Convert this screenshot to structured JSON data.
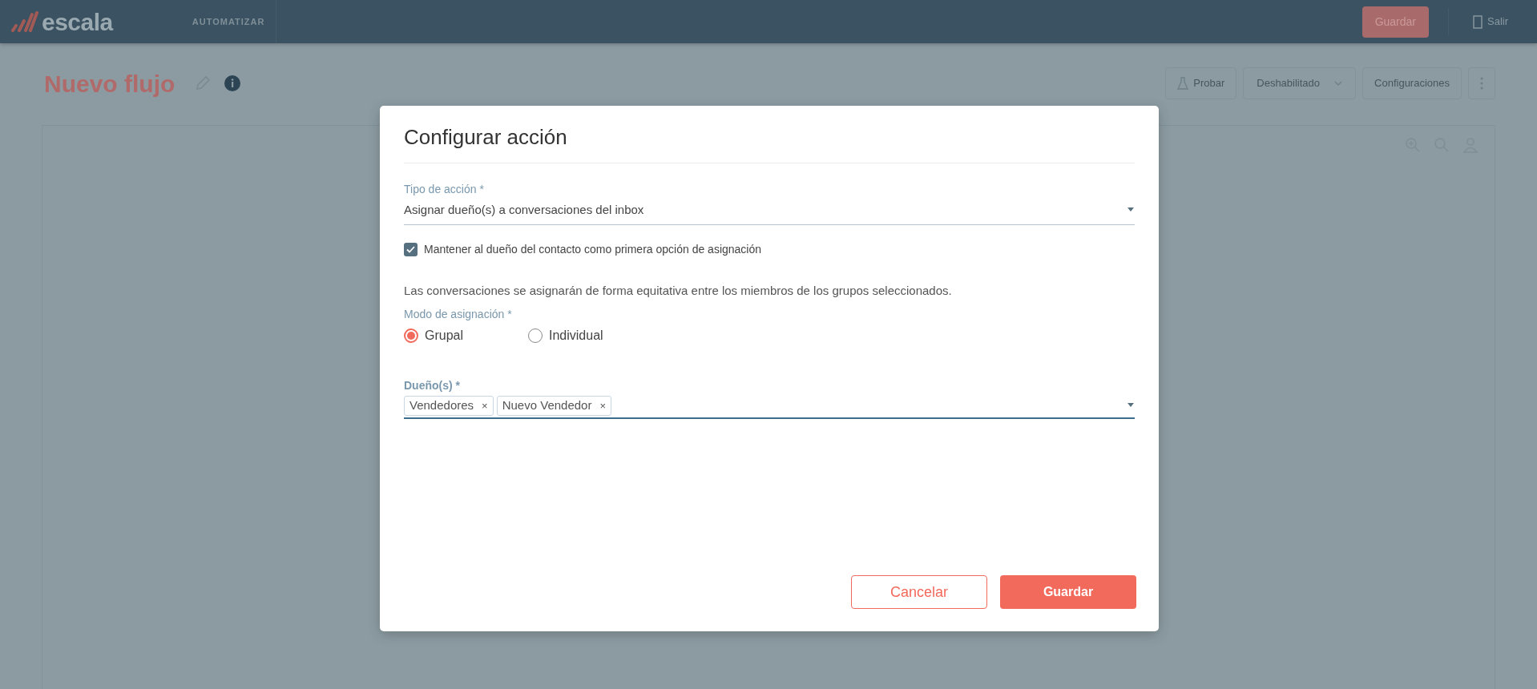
{
  "header": {
    "logo": "escala",
    "nav_item": "AUTOMATIZAR",
    "save_button": "Guardar",
    "exit_button": "Salir"
  },
  "page": {
    "title": "Nuevo flujo",
    "toolbar": [
      {
        "label": "Probar",
        "kind": "icon"
      },
      {
        "label": "Deshabilitado",
        "kind": "dropdown"
      },
      {
        "label": "Configuraciones",
        "kind": "plain"
      }
    ]
  },
  "modal": {
    "title": "Configurar acción",
    "action_type": {
      "label": "Tipo de acción *",
      "value": "Asignar dueño(s) a conversaciones del inbox"
    },
    "keep_owner": {
      "label": "Mantener al dueño del contacto como primera opción de asignación",
      "checked": true
    },
    "info": "Las conversaciones se asignarán de forma equitativa entre los miembros de los grupos seleccionados.",
    "assignment_mode": {
      "label": "Modo de asignación *",
      "options": [
        {
          "label": "Grupal",
          "selected": true
        },
        {
          "label": "Individual",
          "selected": false
        }
      ]
    },
    "owners": {
      "label": "Dueño(s) *",
      "chips": [
        {
          "label": "Vendedores",
          "remove": "×"
        },
        {
          "label": "Nuevo Vendedor",
          "remove": "×"
        }
      ]
    },
    "buttons": [
      {
        "label": "Cancelar",
        "kind": "outline"
      },
      {
        "label": "Guardar",
        "kind": "primary"
      }
    ]
  }
}
